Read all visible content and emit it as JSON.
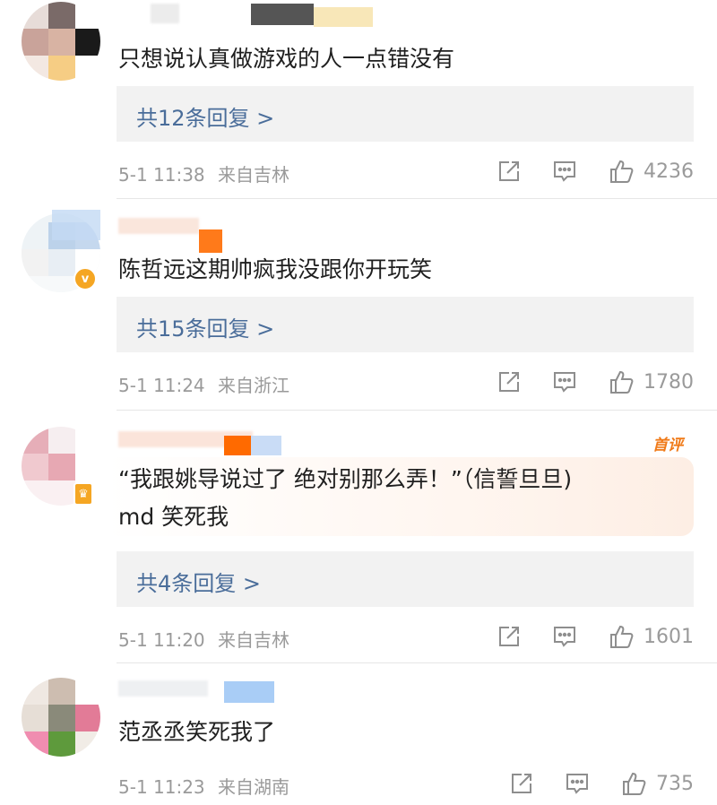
{
  "comments": [
    {
      "text": "只想说认真做游戏的人一点错没有",
      "reply_label": "共12条回复 >",
      "time": "5-1 11:38",
      "location": "来自吉林",
      "likes": "4236"
    },
    {
      "text": "陈哲远这期帅疯我没跟你开玩笑",
      "reply_label": "共15条回复 >",
      "time": "5-1 11:24",
      "location": "来自浙江",
      "likes": "1780"
    },
    {
      "badge": "首评",
      "text_line1": "“我跟姚导说过了 绝对别那么弄！”（信誓旦旦)",
      "text_line2": "md 笑死我",
      "reply_label": "共4条回复 >",
      "time": "5-1 11:20",
      "location": "来自吉林",
      "likes": "1601"
    },
    {
      "text": "范丞丞笑死我了",
      "time": "5-1 11:23",
      "location": "来自湖南",
      "likes": "735"
    }
  ],
  "icons": {
    "share": "share-icon",
    "comment": "comment-icon",
    "like": "thumbs-up-icon"
  },
  "colors": {
    "reply_link": "#4a6d9a",
    "meta": "#9a9a9a",
    "hot_badge": "#f07a18"
  }
}
